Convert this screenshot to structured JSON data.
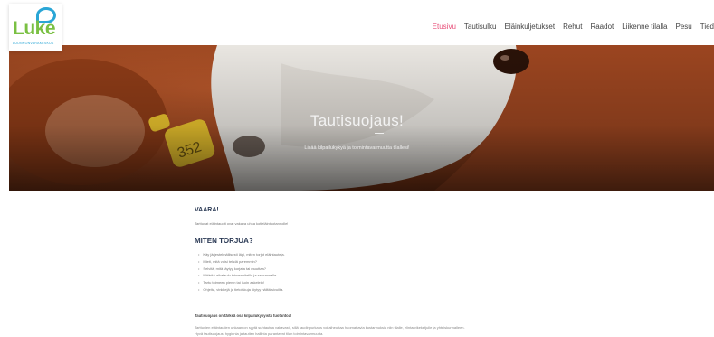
{
  "logo": {
    "word": "Luke",
    "subtitle": "LUONNONVARAKESKUS"
  },
  "nav": {
    "items": [
      "Etusivu",
      "Tautisulku",
      "Eläinkuljetukset",
      "Rehut",
      "Raadot",
      "Liikenne tilalla",
      "Pesu",
      "Tied"
    ],
    "active_index": 0,
    "active_color": "#e8507a"
  },
  "hero": {
    "title": "Tautisuojaus!",
    "subtitle": "Lisää kilpailukykyä ja toimintavarmuutta tilallesi!",
    "ear_tag_number": "352"
  },
  "content": {
    "warning_heading": "VAARA!",
    "warning_text": "Tarttuvat eläintaudit ovat vakava uhka kotieläintuotannolle!",
    "prevent_heading": "MITEN TORJUA?",
    "bullets": [
      "Käy järjestelmällisesti läpi, miten torjut eläintauteja.",
      "Mieti, mitä voisi tehdä paremmin?",
      "Selvitä, mitä täytyy korjata tai muuttaa?",
      "Määritä aikataulu toimenpiteille ja seurannalle.",
      "Tartu toimeen pienin tai isoin askelein!",
      "Ohjeita, vinkkejä ja tietoiskuja löytyy näiltä sivuilta."
    ],
    "bold_statement": "Tautisuojaus on tärkeä osa kilpailukykyistä tuotantoa!",
    "body_text": "Tarttuvien eläintautien uhkaan on syytä suhtautua vakavasti, sillä taudinpurkaus voi aiheuttaa huomattavia kustannuksia niin tilalle, elintarvikeketjulle ja yhteiskunnalleen. Hyvä tautisuojaus, hygienia ja tautien hallinta parantavat tilan toimintavarmuutta."
  },
  "colors": {
    "heading": "#2b3a55",
    "logo_green": "#7ac043",
    "logo_blue": "#2aa6d6"
  }
}
